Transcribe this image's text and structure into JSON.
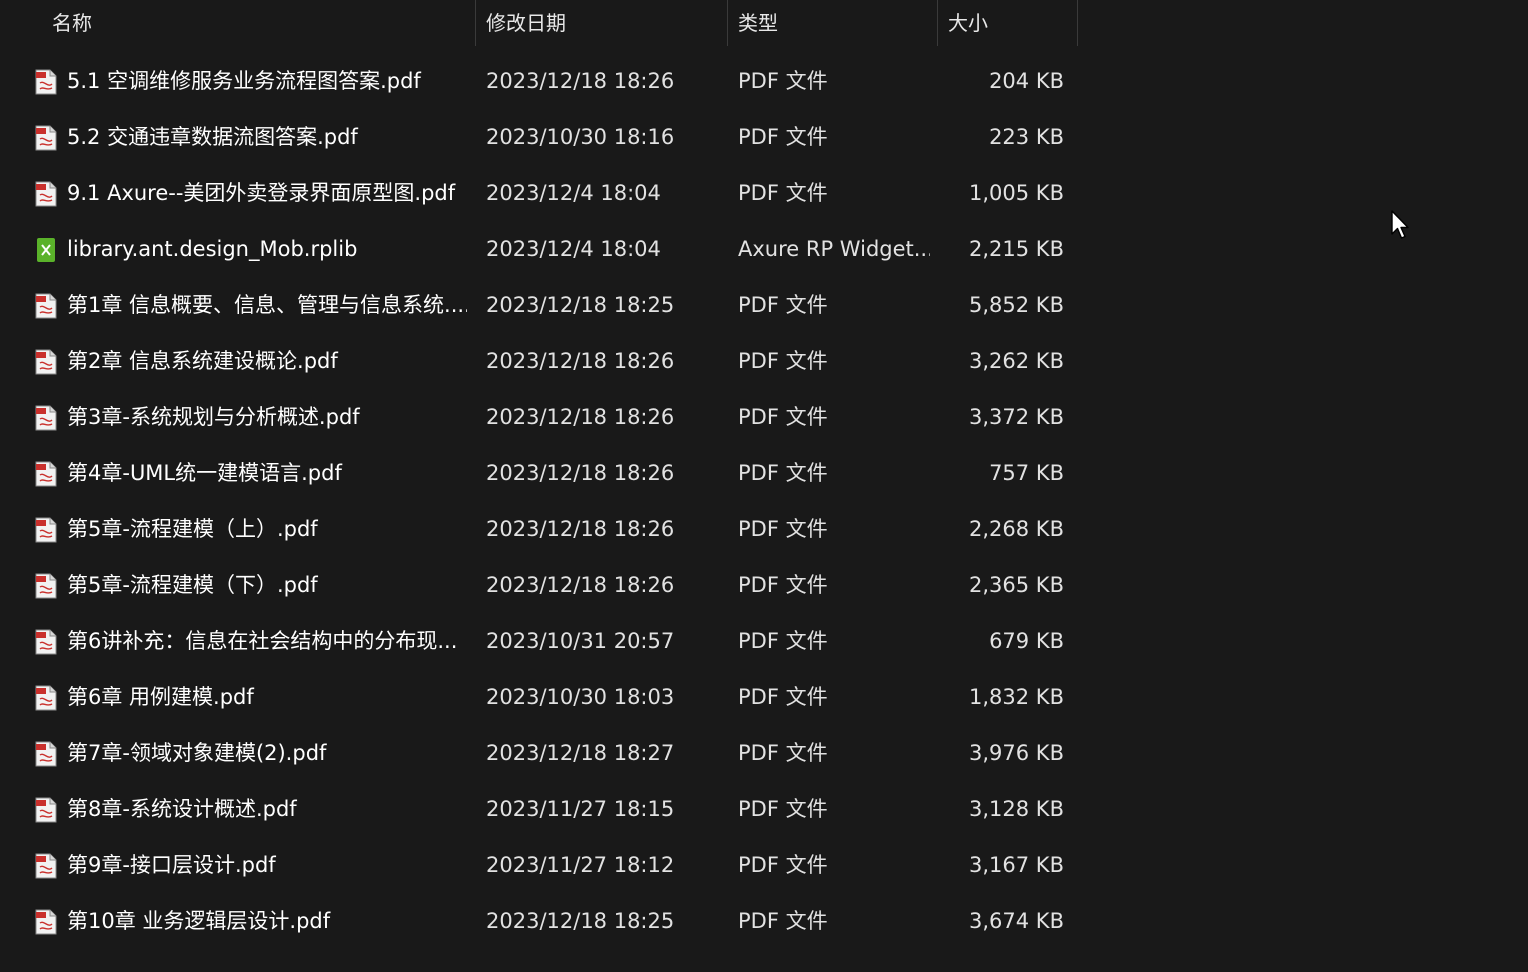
{
  "columns": {
    "name": "名称",
    "date": "修改日期",
    "type": "类型",
    "size": "大小"
  },
  "sort": {
    "column": "name",
    "icon": "sort-up-icon"
  },
  "colors": {
    "background": "#191919",
    "pdf_icon": "#c9302c",
    "rplib_icon": "#5ab22a"
  },
  "files": [
    {
      "name": "5.1 空调维修服务业务流程图答案.pdf",
      "date": "2023/12/18 18:26",
      "type": "PDF 文件",
      "size": "204 KB",
      "icon": "pdf-file-icon"
    },
    {
      "name": "5.2 交通违章数据流图答案.pdf",
      "date": "2023/10/30 18:16",
      "type": "PDF 文件",
      "size": "223 KB",
      "icon": "pdf-file-icon"
    },
    {
      "name": "9.1 Axure--美团外卖登录界面原型图.pdf",
      "date": "2023/12/4 18:04",
      "type": "PDF 文件",
      "size": "1,005 KB",
      "icon": "pdf-file-icon"
    },
    {
      "name": "library.ant.design_Mob.rplib",
      "date": "2023/12/4 18:04",
      "type": "Axure RP Widget...",
      "size": "2,215 KB",
      "icon": "axure-widget-icon"
    },
    {
      "name": "第1章 信息概要、信息、管理与信息系统....",
      "date": "2023/12/18 18:25",
      "type": "PDF 文件",
      "size": "5,852 KB",
      "icon": "pdf-file-icon"
    },
    {
      "name": "第2章 信息系统建设概论.pdf",
      "date": "2023/12/18 18:26",
      "type": "PDF 文件",
      "size": "3,262 KB",
      "icon": "pdf-file-icon"
    },
    {
      "name": "第3章-系统规划与分析概述.pdf",
      "date": "2023/12/18 18:26",
      "type": "PDF 文件",
      "size": "3,372 KB",
      "icon": "pdf-file-icon"
    },
    {
      "name": "第4章-UML统一建模语言.pdf",
      "date": "2023/12/18 18:26",
      "type": "PDF 文件",
      "size": "757 KB",
      "icon": "pdf-file-icon"
    },
    {
      "name": "第5章-流程建模（上）.pdf",
      "date": "2023/12/18 18:26",
      "type": "PDF 文件",
      "size": "2,268 KB",
      "icon": "pdf-file-icon"
    },
    {
      "name": "第5章-流程建模（下）.pdf",
      "date": "2023/12/18 18:26",
      "type": "PDF 文件",
      "size": "2,365 KB",
      "icon": "pdf-file-icon"
    },
    {
      "name": "第6讲补充：信息在社会结构中的分布现...",
      "date": "2023/10/31 20:57",
      "type": "PDF 文件",
      "size": "679 KB",
      "icon": "pdf-file-icon"
    },
    {
      "name": "第6章 用例建模.pdf",
      "date": "2023/10/30 18:03",
      "type": "PDF 文件",
      "size": "1,832 KB",
      "icon": "pdf-file-icon"
    },
    {
      "name": "第7章-领域对象建模(2).pdf",
      "date": "2023/12/18 18:27",
      "type": "PDF 文件",
      "size": "3,976 KB",
      "icon": "pdf-file-icon"
    },
    {
      "name": "第8章-系统设计概述.pdf",
      "date": "2023/11/27 18:15",
      "type": "PDF 文件",
      "size": "3,128 KB",
      "icon": "pdf-file-icon"
    },
    {
      "name": "第9章-接口层设计.pdf",
      "date": "2023/11/27 18:12",
      "type": "PDF 文件",
      "size": "3,167 KB",
      "icon": "pdf-file-icon"
    },
    {
      "name": "第10章 业务逻辑层设计.pdf",
      "date": "2023/12/18 18:25",
      "type": "PDF 文件",
      "size": "3,674 KB",
      "icon": "pdf-file-icon"
    }
  ]
}
